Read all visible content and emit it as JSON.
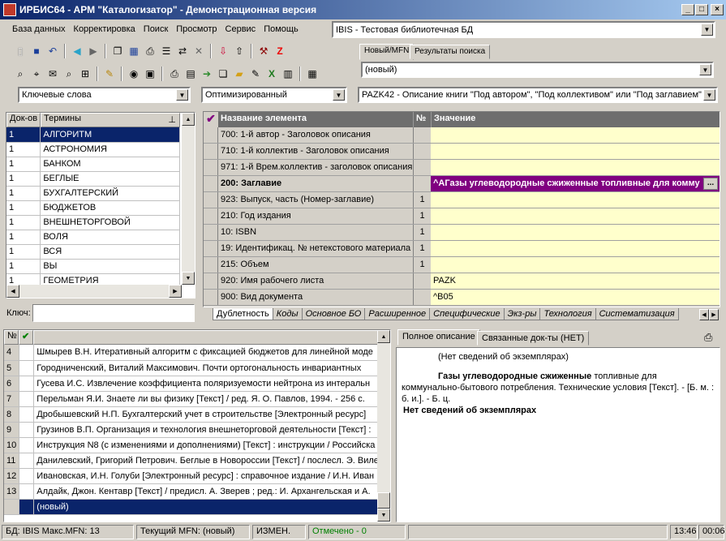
{
  "window": {
    "title": "ИРБИС64 - АРМ \"Каталогизатор\" - Демонстрационная версия"
  },
  "menu": [
    "База данных",
    "Корректировка",
    "Поиск",
    "Просмотр",
    "Сервис",
    "Помощь"
  ],
  "db_combo": {
    "value": "IBIS - Тестовая библиотечная БД"
  },
  "mfn_tabs": [
    "Новый/MFN",
    "Результаты поиска"
  ],
  "mfn_combo": {
    "value": "(новый)"
  },
  "search_mode": {
    "value": "Ключевые слова"
  },
  "format_combo": {
    "value": "Оптимизированный"
  },
  "worksheet_combo": {
    "value": "PAZK42 - Описание книги \"Под автором\", \"Под коллективом\" или \"Под заглавием\""
  },
  "terms": {
    "headers": {
      "count": "Док-ов",
      "term": "Термины"
    },
    "rows": [
      {
        "count": "1",
        "term": "АЛГОРИТМ"
      },
      {
        "count": "1",
        "term": "АСТРОНОМИЯ"
      },
      {
        "count": "1",
        "term": "БАНКОМ"
      },
      {
        "count": "1",
        "term": "БЕГЛЫЕ"
      },
      {
        "count": "1",
        "term": "БУХГАЛТЕРСКИЙ"
      },
      {
        "count": "1",
        "term": "БЮДЖЕТОВ"
      },
      {
        "count": "1",
        "term": "ВНЕШНЕТОРГОВОЙ"
      },
      {
        "count": "1",
        "term": "ВОЛЯ"
      },
      {
        "count": "1",
        "term": "ВСЯ"
      },
      {
        "count": "1",
        "term": "ВЫ"
      },
      {
        "count": "1",
        "term": "ГЕОМЕТРИЯ"
      }
    ],
    "key_label": "Ключ:"
  },
  "fields": {
    "headers": {
      "name": "Название элемента",
      "num": "№",
      "value": "Значение"
    },
    "rows": [
      {
        "name": "700: 1-й  автор - Заголовок описания",
        "num": "",
        "value": ""
      },
      {
        "name": "710: 1-й коллектив - Заголовок описания",
        "num": "",
        "value": ""
      },
      {
        "name": "971: 1-й Врем.коллектив - заголовок описания",
        "num": "",
        "value": ""
      },
      {
        "name": "200: Заглавие",
        "num": "",
        "value": "^AГазы углеводородные сжиженные топливные для комму"
      },
      {
        "name": "923: Выпуск, часть (Номер-заглавие)",
        "num": "1",
        "value": ""
      },
      {
        "name": "210: Год издания",
        "num": "1",
        "value": ""
      },
      {
        "name": "10: ISBN",
        "num": "1",
        "value": ""
      },
      {
        "name": "19: Идентификац. № нетекстового материала",
        "num": "1",
        "value": ""
      },
      {
        "name": "215: Объем",
        "num": "1",
        "value": ""
      },
      {
        "name": "920: Имя рабочего листа",
        "num": "",
        "value": "PAZK"
      },
      {
        "name": "900: Вид документа",
        "num": "",
        "value": "^B05"
      }
    ],
    "ellipsis": "...",
    "tabs": [
      "Дублетность",
      "Коды",
      "Основное БО",
      "Расширенное",
      "Специфические",
      "Экз-ры",
      "Технология",
      "Систематизация"
    ]
  },
  "records": {
    "header_num": "№",
    "rows": [
      {
        "num": "4",
        "text": "Шмырев В.Н. Итеративный алгоритм с фиксацией бюджетов для линейной моде"
      },
      {
        "num": "5",
        "text": "Городниченский, Виталий Максимович. Почти ортогональность инвариантных"
      },
      {
        "num": "6",
        "text": "Гусева И.С. Извлечение коэффициента поляризуемости нейтрона из интеральн"
      },
      {
        "num": "7",
        "text": "Перельман Я.И. Знаете ли вы физику [Текст] / ред. Я. О. Павлов, 1994. - 256 с."
      },
      {
        "num": "8",
        "text": "Дробышевский Н.П. Бухгалтерский учет в строительстве [Электронный ресурс]"
      },
      {
        "num": "9",
        "text": "Грузинов В.П. Организация и технология внешнеторговой деятельности [Текст] : "
      },
      {
        "num": "10",
        "text": "Инструкция N8   (с изменениями и дополнениями) [Текст] : инструкции / Российска"
      },
      {
        "num": "11",
        "text": "Данилевский, Григорий Петрович. Беглые в Новороссии [Текст] / послесл. Э. Виле"
      },
      {
        "num": "12",
        "text": "Ивановская, И.Н. Голуби [Электронный ресурс] : справочное издание / И.Н. Иван"
      },
      {
        "num": "13",
        "text": "Алдайк, Джон. Кентавр [Текст] / предисл. А. Зверев ; ред.: И. Архангельская и А."
      }
    ],
    "new_row": "(новый)"
  },
  "desc": {
    "tabs": [
      "Полное описание",
      "Связанные док-ты (НЕТ)"
    ],
    "line1": "(Нет сведений об экземплярах)",
    "bold_title": "Газы углеводородные сжиженные",
    "rest1": " топливные для",
    "rest2": "коммунально-бытового потребления. Технические условия [Текст]. - [Б. м. :",
    "rest3": "б. и.]. - Б. ц.",
    "line_bold": "Нет сведений об экземплярах"
  },
  "status": {
    "db": "БД: IBIS Макс.MFN: 13",
    "current": "Текущий MFN: (новый)",
    "changed": "ИЗМЕН.",
    "marked": "Отмечено - 0",
    "time": "13:46",
    "elapsed": "00:06"
  },
  "colors": {
    "accent": "#0a246a",
    "value_bg": "#ffffcc",
    "edit_bg": "#800080",
    "marked": "#008000"
  }
}
